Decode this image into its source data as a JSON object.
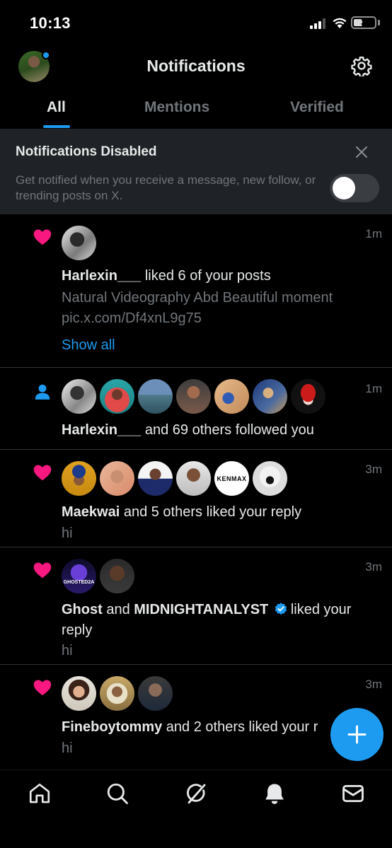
{
  "status_bar": {
    "time": "10:13",
    "battery": "3"
  },
  "header": {
    "title": "Notifications"
  },
  "tabs": [
    {
      "label": "All",
      "active": true
    },
    {
      "label": "Mentions",
      "active": false
    },
    {
      "label": "Verified",
      "active": false
    }
  ],
  "banner": {
    "title": "Notifications Disabled",
    "text": "Get notified when you receive a message, new follow, or trending posts on X.",
    "toggle_on": false
  },
  "notifications": [
    {
      "type": "like",
      "time": "1m",
      "actor": "Harlexin___",
      "action": " liked 6 of your posts",
      "preview_line1": "Natural Videography Abd Beautiful moment",
      "preview_line2": "pic.x.com/Df4xnL9g75",
      "show_all": "Show all"
    },
    {
      "type": "follow",
      "time": "1m",
      "actor": "Harlexin___",
      "action": " and 69 others followed you"
    },
    {
      "type": "like",
      "time": "3m",
      "actor": "Maekwai",
      "action": " and 5 others liked your reply",
      "preview": "hi",
      "avatar_text": "KENMAX"
    },
    {
      "type": "like",
      "time": "3m",
      "actor": "Ghost",
      "connector": " and ",
      "actor2": "MIDNIGHTANALYST",
      "action": "liked your",
      "action_line2": "reply",
      "preview": "hi",
      "avatar_text": "GHOSTED2A"
    },
    {
      "type": "like",
      "time": "3m",
      "actor": "Fineboytommy",
      "action": " and 2 others liked your r",
      "preview": "hi"
    }
  ],
  "colors": {
    "accent": "#1d9bf0",
    "heart": "#f91880",
    "muted": "#71767b"
  },
  "bottom_nav": [
    "home-icon",
    "search-icon",
    "grok-icon",
    "notifications-icon",
    "messages-icon"
  ]
}
